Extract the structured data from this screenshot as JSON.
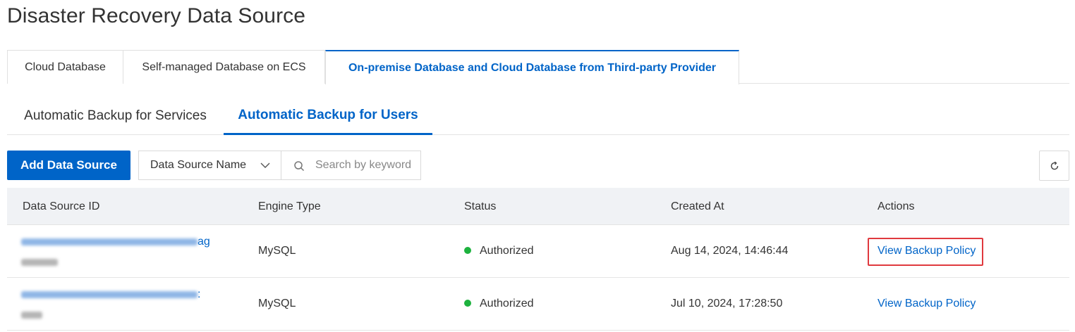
{
  "page": {
    "title": "Disaster Recovery Data Source"
  },
  "primary_tabs": [
    {
      "label": "Cloud Database",
      "active": false
    },
    {
      "label": "Self-managed Database on ECS",
      "active": false
    },
    {
      "label": "On-premise Database and Cloud Database from Third-party Provider",
      "active": true
    }
  ],
  "secondary_tabs": [
    {
      "label": "Automatic Backup for Services",
      "active": false
    },
    {
      "label": "Automatic Backup for Users",
      "active": true
    }
  ],
  "toolbar": {
    "add_label": "Add Data Source",
    "filter_selected": "Data Source Name",
    "search_placeholder": "Search by keyword"
  },
  "table": {
    "columns": [
      "Data Source ID",
      "Engine Type",
      "Status",
      "Created At",
      "Actions"
    ],
    "rows": [
      {
        "id_visible_suffix": "ag",
        "engine": "MySQL",
        "status": "Authorized",
        "created_at": "Aug 14, 2024, 14:46:44",
        "action": "View Backup Policy",
        "highlighted": true
      },
      {
        "id_visible_suffix": ":",
        "engine": "MySQL",
        "status": "Authorized",
        "created_at": "Jul 10, 2024, 17:28:50",
        "action": "View Backup Policy",
        "highlighted": false
      }
    ]
  },
  "colors": {
    "accent": "#0064c8",
    "status_ok": "#1db23e",
    "highlight": "#e0393e",
    "header_bg": "#f0f2f5"
  },
  "icons": {
    "filter_dropdown": "chevron-down-icon",
    "search": "search-icon",
    "refresh": "refresh-icon",
    "status": "status-dot-icon"
  }
}
